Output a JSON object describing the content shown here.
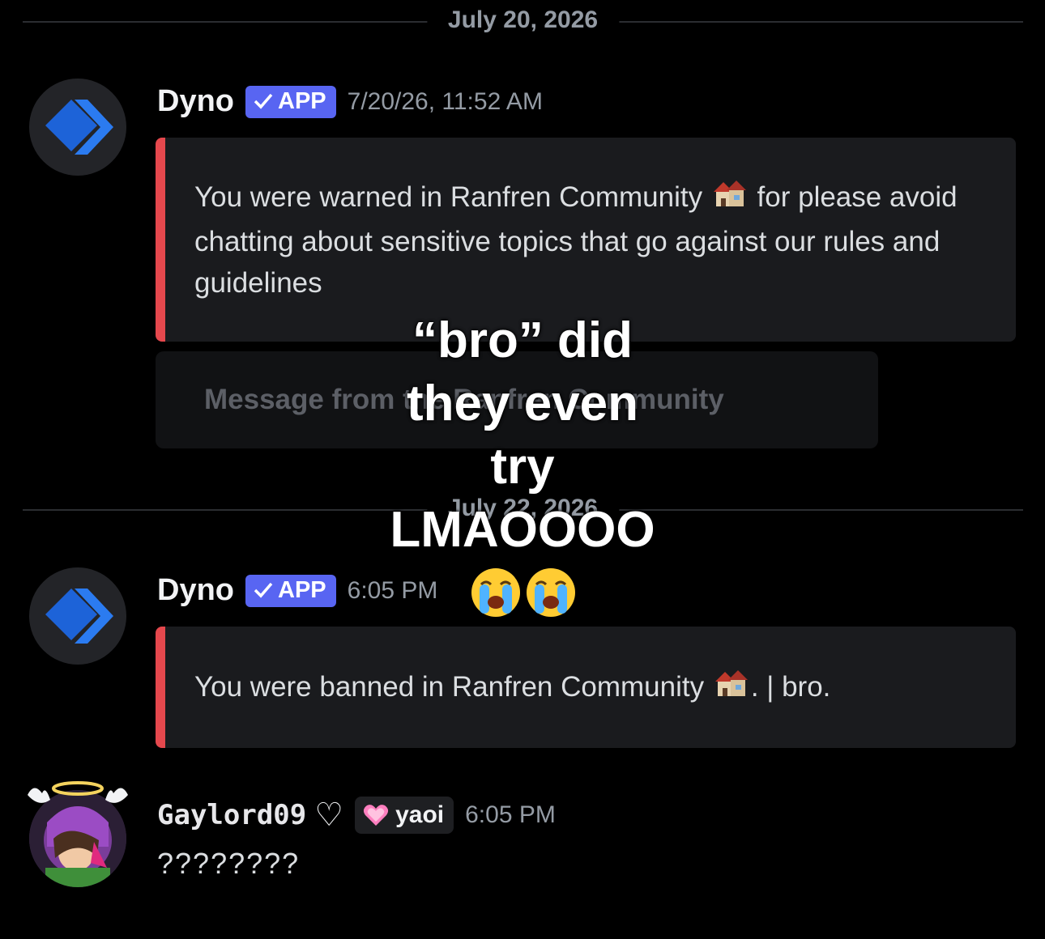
{
  "dividers": {
    "first": "July 20, 2026",
    "second": "July 22, 2026"
  },
  "messages": [
    {
      "author": "Dyno",
      "badge": "APP",
      "timestamp": "7/20/26, 11:52 AM",
      "embed_text_before": "You were warned in Ranfren Community",
      "embed_text_after": " for please avoid chatting about sensitive topics that go against our rules and guidelines",
      "accent_color": "#e5484d"
    },
    {
      "author": "Dyno",
      "badge": "APP",
      "timestamp": "6:05 PM",
      "embed_text_before": "You were banned in Ranfren Community",
      "embed_text_after": ". | bro.",
      "accent_color": "#e5484d"
    },
    {
      "author": "Gaylord09",
      "author_suffix": "♡",
      "role": "yaoi",
      "timestamp": "6:05 PM",
      "text": "????????"
    }
  ],
  "notice": {
    "text": "Message from the Ranfren Community"
  },
  "overlay_caption": {
    "lines": [
      "“bro” did",
      "they even",
      "try",
      "LMAOOOO"
    ],
    "emoji": "😭😭"
  },
  "colors": {
    "background": "#000000",
    "app_badge": "#5865f2",
    "embed_bg": "#1a1b1e",
    "muted": "#949ba4"
  },
  "icons": [
    "dyno-logo-icon",
    "checkmark-icon",
    "house-emoji-icon",
    "heart-icon",
    "crying-emoji-icon"
  ]
}
